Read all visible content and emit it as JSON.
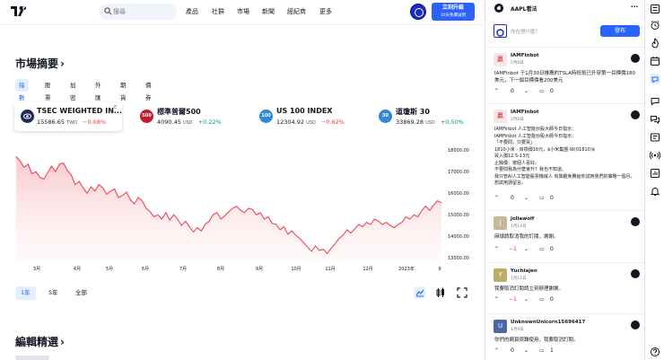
{
  "nav": {
    "search_placeholder": "搜尋",
    "items": [
      "產品",
      "社群",
      "市場",
      "新聞",
      "經紀商",
      "更多"
    ],
    "upgrade_line1": "立刻升級",
    "upgrade_line2": "30天免費試用"
  },
  "market": {
    "title": "市場摘要",
    "chevron": "›",
    "tabs": [
      "指數",
      "股票",
      "加密",
      "外匯",
      "期貨",
      "債券"
    ],
    "cards": [
      {
        "badge": "",
        "name": "TSEC WEIGHTED IN...",
        "flag": "E",
        "value": "15586.65",
        "currency": "TWD",
        "change": "−0.08%",
        "direction": "down"
      },
      {
        "badge": "500",
        "name": "標準普爾500",
        "flag": "",
        "value": "4090.45",
        "currency": "USD",
        "change": "+0.22%",
        "direction": "up"
      },
      {
        "badge": "100",
        "name": "US 100 INDEX",
        "flag": "",
        "value": "12304.92",
        "currency": "USD",
        "change": "−0.62%",
        "direction": "down"
      },
      {
        "badge": "30",
        "name": "道瓊斯 30",
        "flag": "",
        "value": "33869.28",
        "currency": "USD",
        "change": "+0.50%",
        "direction": "up"
      }
    ],
    "ranges": [
      "1年",
      "5年",
      "全部"
    ],
    "active_range": "1年"
  },
  "chart_data": {
    "type": "area",
    "title": "",
    "x_ticks": [
      "3月",
      "4月",
      "5月",
      "6月",
      "7月",
      "8月",
      "9月",
      "10月",
      "11月",
      "12月",
      "2023年",
      "9"
    ],
    "y_ticks": [
      "18000.00",
      "17000.00",
      "16000.00",
      "15000.00",
      "14000.00",
      "13000.00"
    ],
    "ylim": [
      12800,
      18300
    ],
    "series": [
      {
        "values": [
          17700,
          17500,
          17200,
          17350,
          16900,
          17000,
          16750,
          16650,
          16950,
          17250,
          17000,
          17350,
          17400,
          17050,
          16850,
          16400,
          16550,
          16250,
          16000,
          16300,
          16100,
          16400,
          16250,
          15950,
          16100,
          16200,
          15800,
          15900,
          16050,
          15700,
          15500,
          15800,
          15650,
          15300,
          15150,
          14900,
          15000,
          14800,
          15100,
          14750,
          15000,
          14800,
          14500,
          14700,
          14450,
          14200,
          14400,
          14250,
          14550,
          14700,
          15000,
          15100,
          14800,
          14950,
          15150,
          15300,
          15400,
          15200,
          15100,
          15300,
          15250,
          15000,
          15100,
          14800,
          14900,
          14600,
          14550,
          14300,
          14450,
          14100,
          14250,
          14050,
          13900,
          13700,
          13500,
          13300,
          13550,
          13350,
          13400,
          13200,
          13450,
          13650,
          13900,
          14050,
          14300,
          14150,
          14350,
          14550,
          14450,
          14650,
          14550,
          14800,
          14700,
          14550,
          14650,
          14500,
          14400,
          14550,
          14650,
          14900,
          14800,
          15000,
          14900,
          15200,
          15400,
          15200,
          15450,
          15650,
          15550
        ]
      }
    ],
    "line_color": "#f23645",
    "fill_color": "#fde3e5",
    "grid": false
  },
  "editors_pick": {
    "title": "編輯精選",
    "chevron": "›"
  },
  "feed": {
    "header": "AAPL看法",
    "post_placeholder": "你在想什麼？",
    "post_button": "發布",
    "posts": [
      {
        "avatar": "贏",
        "author": "IAMFinbot",
        "date": "2月8日",
        "body": "IAMFinbot 于1月30日推薦的TSLA時抵抵已升穿第一目標價180美元，下一個目標價看200美元",
        "likes": "0",
        "comments": "0"
      },
      {
        "avatar": "贏",
        "author": "IAMFinbot",
        "date": "2月8日",
        "body": "IAMFinbot 人工智能炒股大師今日指示：\nIAMFinbot 人工智能炒股大師今日指示：\n「不要問，只要買」\n1810小米 - 目標價16元，$小米集團-W(01810)$\n買入價12.5-13元\n止蝕價：按個人喜好。\n不要問我為什麼會升？我也不知道。\n我只管AI人工智能股票機械人 有興趣免費給你試用我們的策略一個月，想試用請留言。",
        "likes": "0",
        "comments": "0"
      },
      {
        "avatar": "J",
        "author": "jollawolf",
        "date": "1月14日",
        "body": "麻煩請取消我的訂閱，謝謝。",
        "likes": "−1",
        "comments": "0"
      },
      {
        "avatar": "Y",
        "author": "Yuchiajen",
        "date": "1月11日",
        "body": "我要取消訂閱請立刻辦理謝謝。",
        "likes": "−1",
        "comments": "0"
      },
      {
        "avatar": "U",
        "author": "UnknownUnicorn15696417",
        "date": "1月9日",
        "body": "你們的網頁很難使用，我要取消訂閱。",
        "likes": "0",
        "comments": "1"
      }
    ]
  },
  "colors": {
    "accent": "#2962ff",
    "down": "#f23645",
    "up": "#089981"
  }
}
